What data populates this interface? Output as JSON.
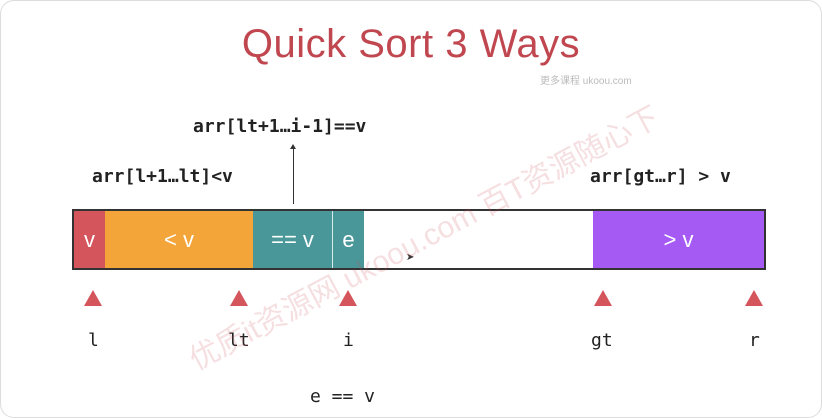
{
  "title": "Quick Sort 3 Ways",
  "labels": {
    "equal_range": "arr[lt+1…i-1]==v",
    "less_range": "arr[l+1…lt]<v",
    "greater_range": "arr[gt…r] > v",
    "condition": "e == v"
  },
  "segments": {
    "pivot": "v",
    "less": "< v",
    "equal": "== v",
    "current": "e",
    "unprocessed": "",
    "greater": "> v"
  },
  "indices": {
    "l": "l",
    "lt": "lt",
    "i": "i",
    "gt": "gt",
    "r": "r"
  },
  "watermark": "优质it资源网 ukoou.com 百T资源随心下",
  "watermark_small": "更多课程 ukoou.com",
  "colors": {
    "title": "#c0474f",
    "pivot": "#d4555c",
    "less": "#f3a53a",
    "equal": "#4a979a",
    "greater": "#a55af4",
    "marker": "#d4555c"
  }
}
